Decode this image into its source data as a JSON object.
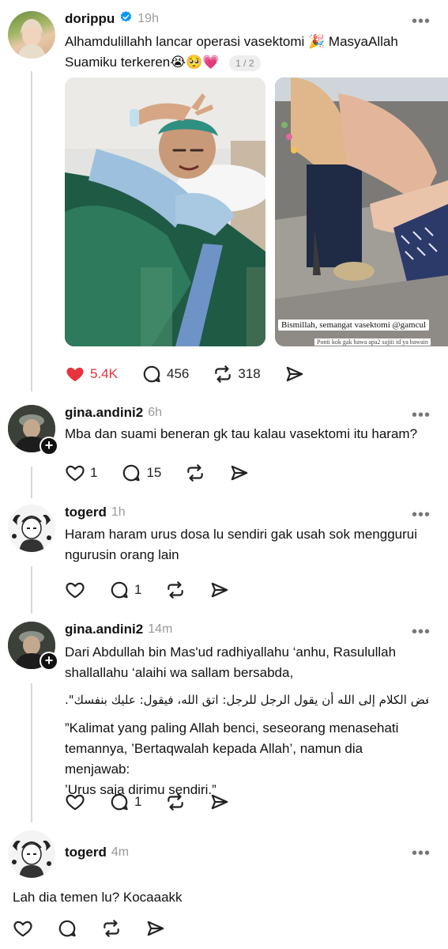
{
  "post": {
    "username": "dorippu",
    "verified_icon": "verified-badge-icon",
    "time": "19h",
    "text_line1": "Alhamdulillahh lancar operasi vasektomi 🎉 MasyaAllah",
    "text_line2": "Suamiku terkeren😭🥺💗",
    "page_indicator": "1 / 2",
    "photo2_caption": "Bismillah, semangat vasektomi @gamcul",
    "photo2_caption_sub": "Ponti kok gak bawa apa2 sajiii id ya bawain",
    "likes": "5.4K",
    "replies": "456",
    "reposts": "318",
    "colors": {
      "like": "#e8323c",
      "accent_teal": "#2f8f80"
    }
  },
  "comments": [
    {
      "username": "gina.andini2",
      "time": "6h",
      "text": "Mba dan suami beneran gk tau kalau vasektomi itu haram?",
      "likes": "1",
      "replies": "15"
    },
    {
      "username": "togerd",
      "time": "1h",
      "text_line1": "Haram haram urus dosa lu sendiri gak usah sok menggurui",
      "text_line2": "ngurusin orang lain",
      "replies": "1"
    },
    {
      "username": "gina.andini2",
      "time": "14m",
      "text_line1": "Dari Abdullah bin Mas'ud radhiyallahu ‘anhu, Rasulullah",
      "text_line2": "shallallahu ‘alaihi wa sallam bersabda,",
      "arabic": ".\"إن أبغض الكلام إلى الله أن يقول الرجل للرجل: اتق الله، فيقول: عليك بنفسك",
      "quote_line1": "”Kalimat yang paling Allah benci, seseorang menasehati",
      "quote_line2": "temannya, ’Bertaqwalah kepada Allah’, namun dia menjawab:",
      "quote_line3": "’Urus saja dirimu sendiri.”",
      "replies": "1"
    },
    {
      "username": "togerd",
      "time": "4m",
      "text": "Lah dia temen lu? Kocaaakk"
    }
  ]
}
